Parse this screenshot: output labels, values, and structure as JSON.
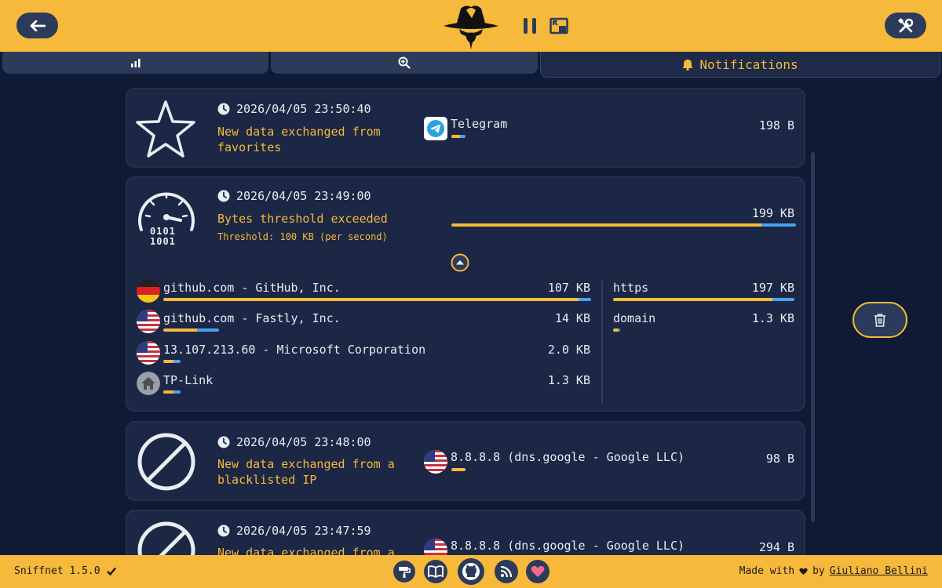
{
  "tabs": {
    "overview_icon": "chart-icon",
    "inspect_icon": "zoom-icon",
    "notifications_label": "Notifications"
  },
  "notifications": [
    {
      "timestamp": "2026/04/05 23:50:40",
      "description": "New data exchanged from favorites",
      "entity": "Telegram",
      "bytes": "198 B",
      "in_fraction": 0.6
    },
    {
      "timestamp": "2026/04/05 23:49:00",
      "description": "Bytes threshold exceeded",
      "threshold": "Threshold: 100 KB (per second)",
      "bytes": "199 KB",
      "in_fraction": 0.9,
      "gauge_text_1": "0101",
      "gauge_text_2": "1001",
      "hosts": [
        {
          "label": "github.com - GitHub, Inc.",
          "value": "107 KB",
          "flag": "DE",
          "bar_fraction": 1.0,
          "in_fraction": 0.97
        },
        {
          "label": "github.com - Fastly, Inc.",
          "value": "14 KB",
          "flag": "US",
          "bar_fraction": 0.13,
          "in_fraction": 0.6
        },
        {
          "label": "13.107.213.60 - Microsoft Corporation",
          "value": "2.0 KB",
          "flag": "US",
          "bar_fraction": 0.04,
          "in_fraction": 0.6
        },
        {
          "label": "TP-Link",
          "value": "1.3 KB",
          "flag": "home",
          "bar_fraction": 0.04,
          "in_fraction": 0.6
        }
      ],
      "services": [
        {
          "label": "https",
          "value": "197 KB",
          "bar_fraction": 1.0,
          "in_fraction": 0.88
        },
        {
          "label": "domain",
          "value": "1.3 KB",
          "bar_fraction": 0.04,
          "in_fraction": 0.6
        }
      ]
    },
    {
      "timestamp": "2026/04/05 23:48:00",
      "description": "New data exchanged from a blacklisted IP",
      "entity": "8.8.8.8 (dns.google - Google LLC)",
      "bytes": "98 B",
      "in_fraction": 1.0
    },
    {
      "timestamp": "2026/04/05 23:47:59",
      "description": "New data exchanged from a",
      "entity": "8.8.8.8 (dns.google - Google LLC)",
      "bytes": "294 B",
      "in_fraction": 1.0
    }
  ],
  "footer": {
    "version": "Sniffnet 1.5.0",
    "made_with": "Made with",
    "by": "by",
    "author": "Giuliano Bellini"
  },
  "colors": {
    "accent": "#f6b93b",
    "background": "#0f1b34",
    "card": "#1b2744",
    "incoming": "#f6b93b",
    "outgoing": "#47a3f3"
  }
}
